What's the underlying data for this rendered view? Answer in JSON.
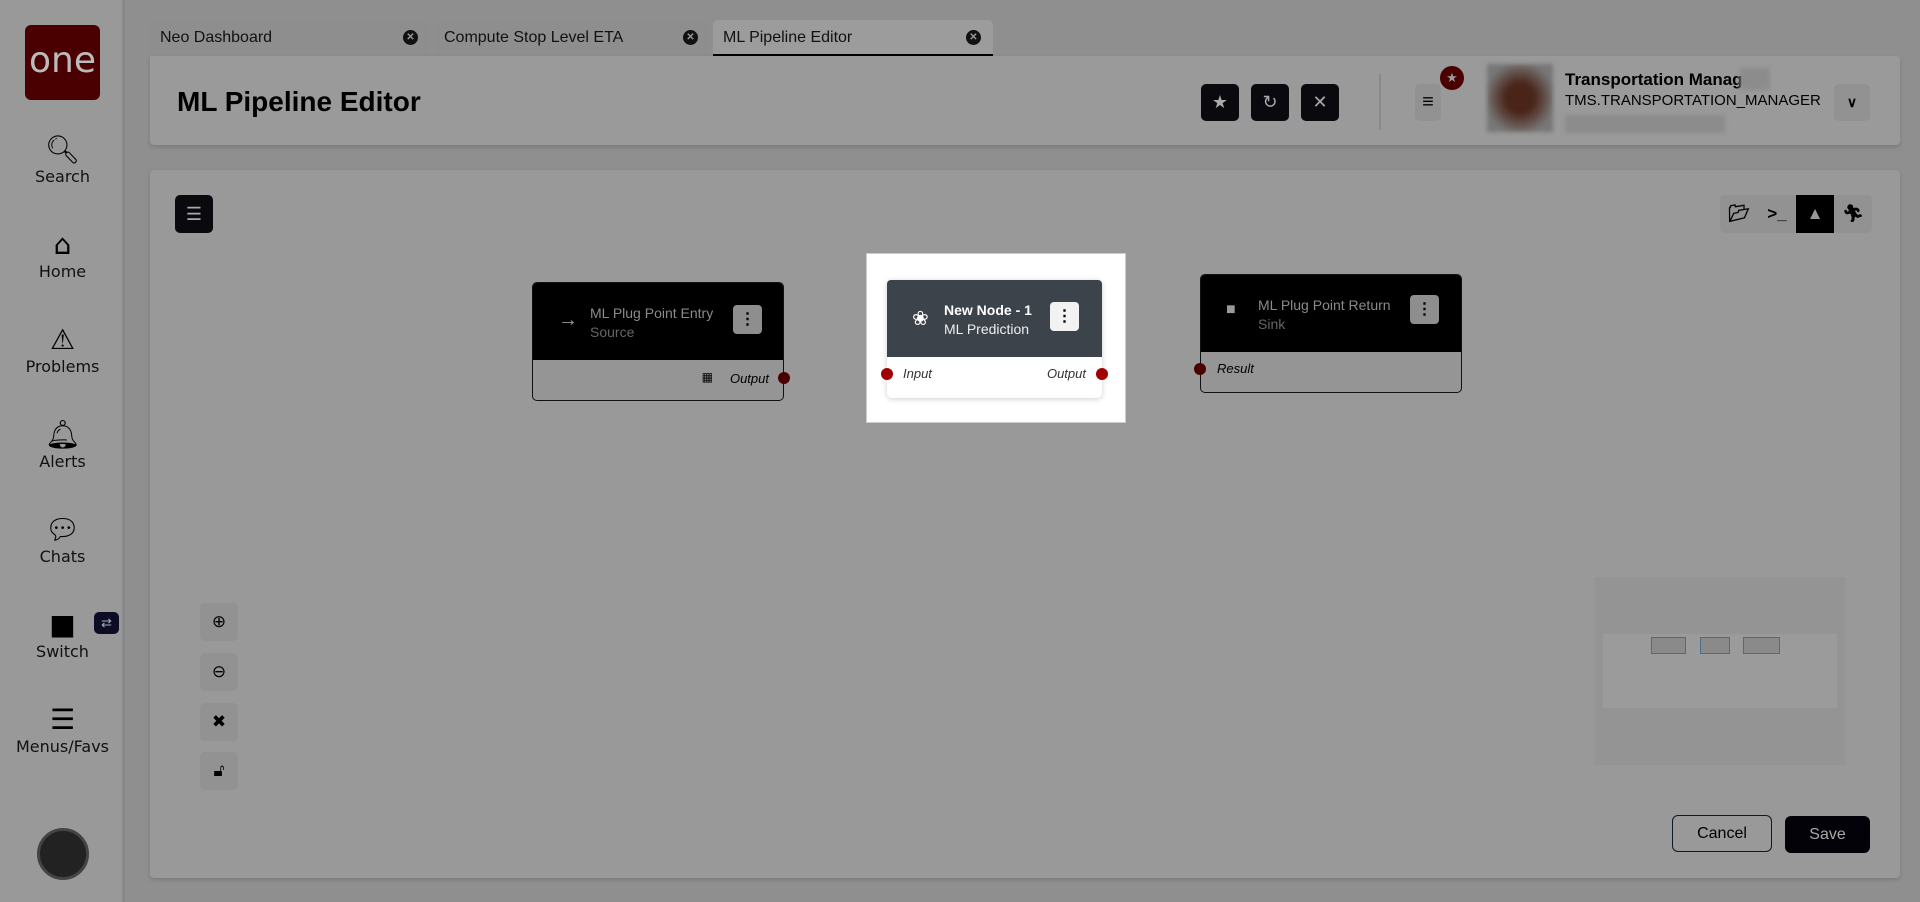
{
  "sidebar": {
    "logo": "one",
    "items": [
      {
        "label": "Search",
        "icon": "search-icon"
      },
      {
        "label": "Home",
        "icon": "home-icon"
      },
      {
        "label": "Problems",
        "icon": "warning-icon"
      },
      {
        "label": "Alerts",
        "icon": "bell-icon"
      },
      {
        "label": "Chats",
        "icon": "chat-icon"
      },
      {
        "label": "Switch",
        "icon": "switch-icon"
      },
      {
        "label": "Menus/Favs",
        "icon": "menu-icon"
      }
    ]
  },
  "tabs": [
    {
      "label": "Neo Dashboard"
    },
    {
      "label": "Compute Stop Level ETA"
    },
    {
      "label": "ML Pipeline Editor",
      "active": true
    }
  ],
  "header": {
    "title": "ML Pipeline Editor",
    "user_name": "Transportation Manager",
    "user_role": "TMS.TRANSPORTATION_MANAGER"
  },
  "nodes": [
    {
      "title": "ML Plug Point Entry",
      "subtitle": "Source",
      "ports": {
        "output": "Output"
      }
    },
    {
      "title": "New Node - 1",
      "subtitle": "ML Prediction",
      "ports": {
        "input": "Input",
        "output": "Output"
      }
    },
    {
      "title": "ML Plug Point Return",
      "subtitle": "Sink",
      "ports": {
        "input": "Result"
      }
    }
  ],
  "actions": {
    "cancel": "Cancel",
    "save": "Save"
  },
  "colors": {
    "brand": "#4a0000",
    "port": "#8b0000",
    "active_node_header": "#3d434b"
  }
}
